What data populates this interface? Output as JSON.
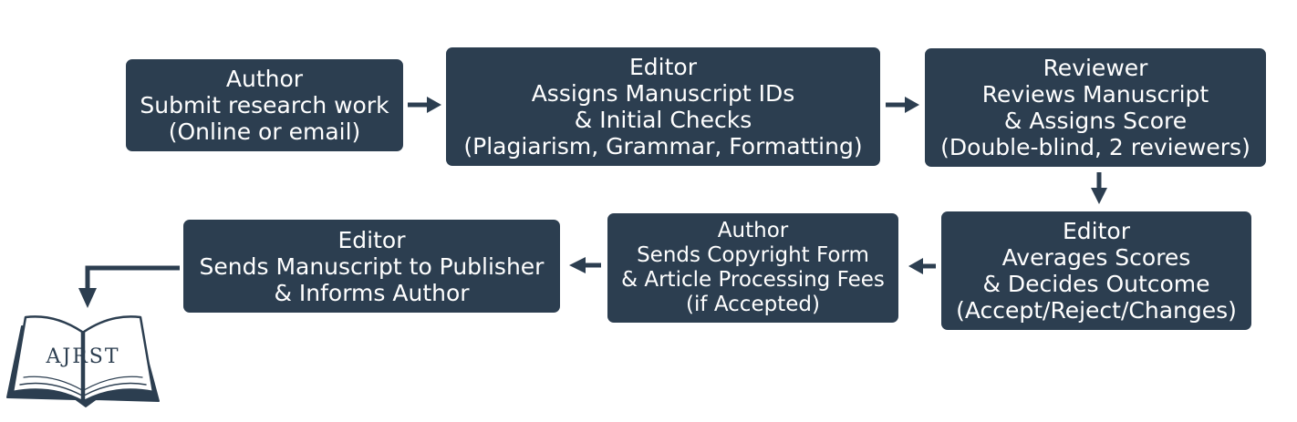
{
  "steps": {
    "author_submit": {
      "lines": [
        "Author",
        "Submit research work",
        "(Online or email)"
      ]
    },
    "editor_assign": {
      "lines": [
        "Editor",
        "Assigns Manuscript IDs",
        "& Initial Checks",
        "(Plagiarism, Grammar, Formatting)"
      ]
    },
    "reviewer_review": {
      "lines": [
        "Reviewer",
        "Reviews Manuscript",
        "& Assigns Score",
        "(Double-blind, 2 reviewers)"
      ]
    },
    "editor_decide": {
      "lines": [
        "Editor",
        "Averages Scores",
        "& Decides Outcome",
        "(Accept/Reject/Changes)"
      ]
    },
    "author_copyright": {
      "lines": [
        "Author",
        "Sends Copyright Form",
        "& Article Processing Fees",
        "(if Accepted)"
      ]
    },
    "editor_publish": {
      "lines": [
        "Editor",
        "Sends Manuscript to Publisher",
        "& Informs Author"
      ]
    }
  },
  "logo": {
    "text": "AJRST"
  },
  "colors": {
    "box_fill": "#2c3e50",
    "box_text": "#ffffff",
    "arrow": "#2c3e50",
    "background": "#ffffff"
  }
}
